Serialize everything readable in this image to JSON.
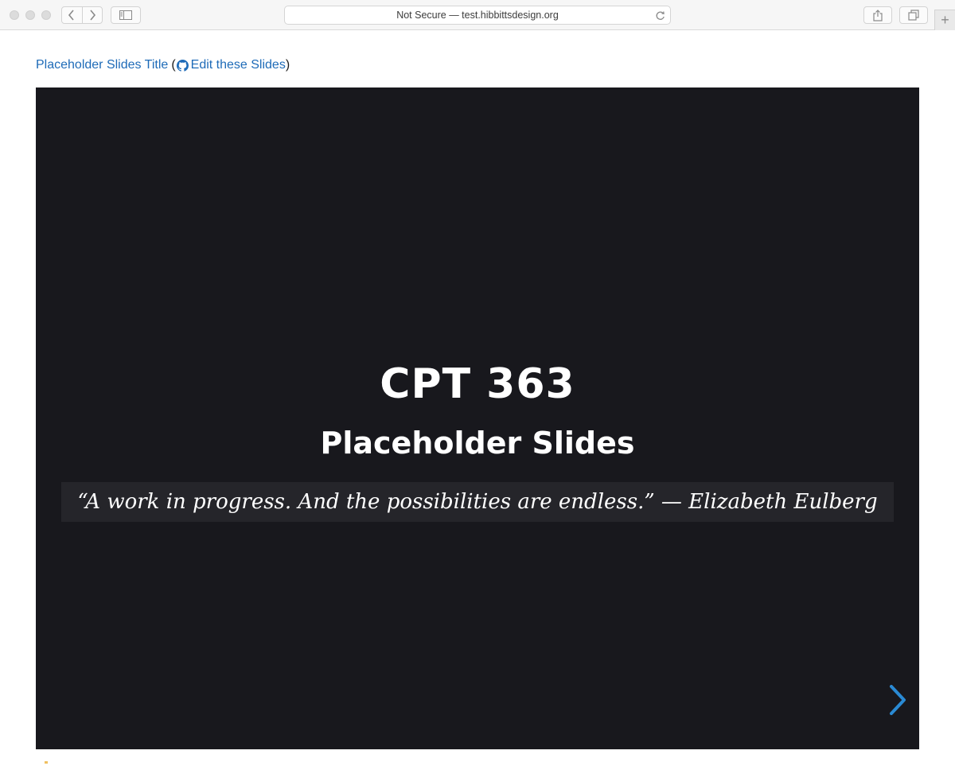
{
  "browser": {
    "address_text": "Not Secure — test.hibbittsdesign.org",
    "new_tab_label": "+"
  },
  "header": {
    "title_link": "Placeholder Slides Title",
    "open_paren": "(",
    "edit_link": "Edit these Slides",
    "close_paren": ")"
  },
  "slide": {
    "title": "CPT 363",
    "subtitle": "Placeholder Slides",
    "quote": "“A work in progress. And the possibilities are endless.” — Elizabeth Eulberg"
  },
  "colors": {
    "link": "#1e6bb8",
    "slide_background": "#18181d",
    "quote_band": "#25252a",
    "next_arrow": "#2a8ad4"
  },
  "icons": {
    "back": "chevron-left-icon",
    "forward": "chevron-right-icon",
    "sidebar": "sidebar-icon",
    "reload": "reload-icon",
    "share": "share-icon",
    "tabs": "tabs-icon",
    "github": "github-icon",
    "next": "chevron-right-icon"
  }
}
